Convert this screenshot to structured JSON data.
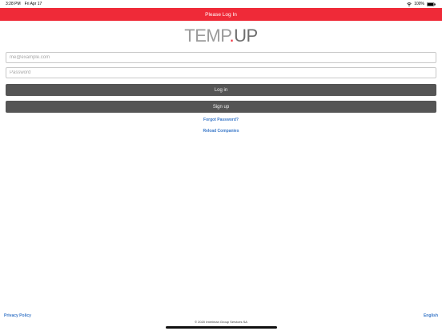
{
  "status_bar": {
    "time": "3:28 PM",
    "date": "Fri Apr 17",
    "battery": "100%"
  },
  "nav": {
    "title": "Please Log In"
  },
  "logo": {
    "part1": "TEMP",
    "dot": ".",
    "part2": "UP"
  },
  "form": {
    "email_value": "",
    "email_placeholder": "me@example.com",
    "password_value": "",
    "password_placeholder": "Password",
    "login_label": "Log in",
    "signup_label": "Sign up",
    "forgot_label": "Forgot Password?",
    "reload_label": "Reload Companies"
  },
  "footer": {
    "privacy_label": "Privacy Policy",
    "language_label": "English",
    "copyright": "© 2020 Interiman Group Services SA"
  },
  "colors": {
    "nav_bg": "#ef2a38",
    "button_bg": "#555555",
    "link": "#3a78c8"
  },
  "icons": {
    "wifi": "wifi-icon",
    "battery": "battery-icon"
  }
}
